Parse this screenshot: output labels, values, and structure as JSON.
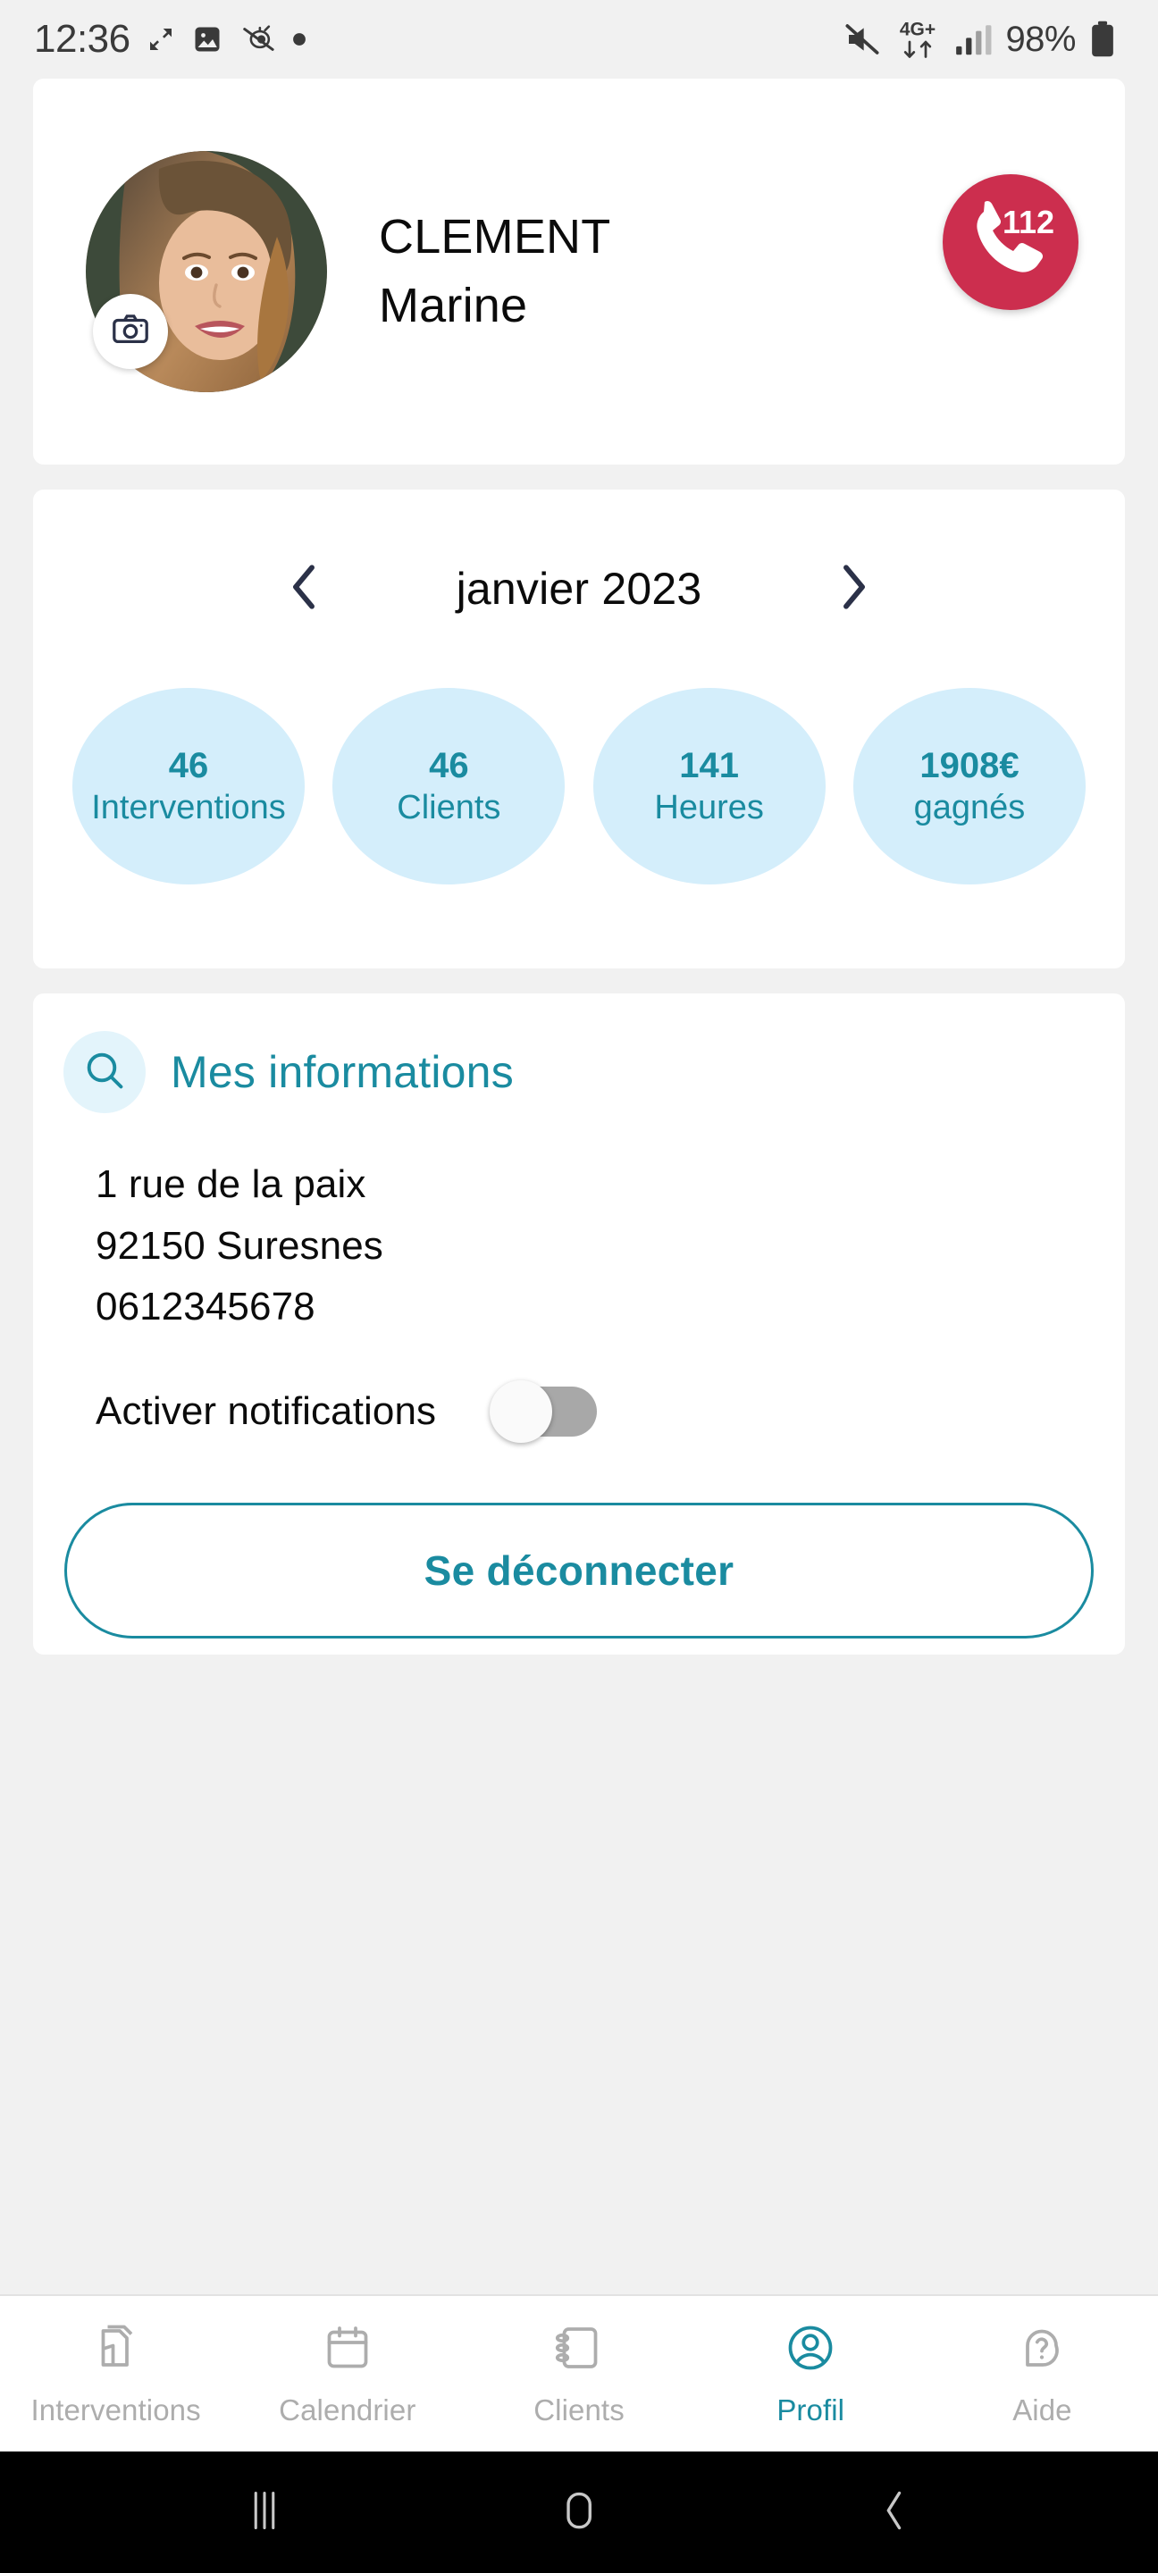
{
  "statusbar": {
    "time": "12:36",
    "battery_percent": "98%",
    "network_type": "4G+",
    "left_icons": [
      "resize-icon",
      "image-icon",
      "mute-bell-icon",
      "dot-icon"
    ],
    "right_icons": [
      "volume-mute-icon",
      "network-4gplus-icon",
      "signal-bars-icon",
      "battery-icon"
    ]
  },
  "profile": {
    "last_name": "CLEMENT",
    "first_name": "Marine",
    "camera_badge_icon": "camera-icon",
    "emergency": {
      "number": "112",
      "icon": "phone-icon",
      "color": "#cc2e4e"
    }
  },
  "stats": {
    "month_label": "janvier 2023",
    "prev_icon": "chevron-left-icon",
    "next_icon": "chevron-right-icon",
    "bubbles": [
      {
        "value": "46",
        "label": "Interventions"
      },
      {
        "value": "46",
        "label": "Clients"
      },
      {
        "value": "141",
        "label": "Heures"
      },
      {
        "value": "1908€",
        "label": "gagnés"
      }
    ],
    "bubble_bg": "#d4eefb",
    "bubble_text": "#1a8ba0"
  },
  "info": {
    "icon": "search-icon",
    "title": "Mes informations",
    "lines": [
      "1 rue de la paix",
      "92150 Suresnes",
      "0612345678"
    ],
    "notifications_label": "Activer notifications",
    "notifications_enabled": false,
    "logout_label": "Se déconnecter",
    "accent": "#1a8ba0"
  },
  "tabbar": {
    "active": "Profil",
    "items": [
      {
        "label": "Interventions",
        "icon": "documents-icon"
      },
      {
        "label": "Calendrier",
        "icon": "calendar-icon"
      },
      {
        "label": "Clients",
        "icon": "address-book-icon"
      },
      {
        "label": "Profil",
        "icon": "user-circle-icon"
      },
      {
        "label": "Aide",
        "icon": "help-question-icon"
      }
    ]
  },
  "navbar": {
    "recents_icon": "recents-icon",
    "home_icon": "home-icon",
    "back_icon": "back-icon"
  }
}
